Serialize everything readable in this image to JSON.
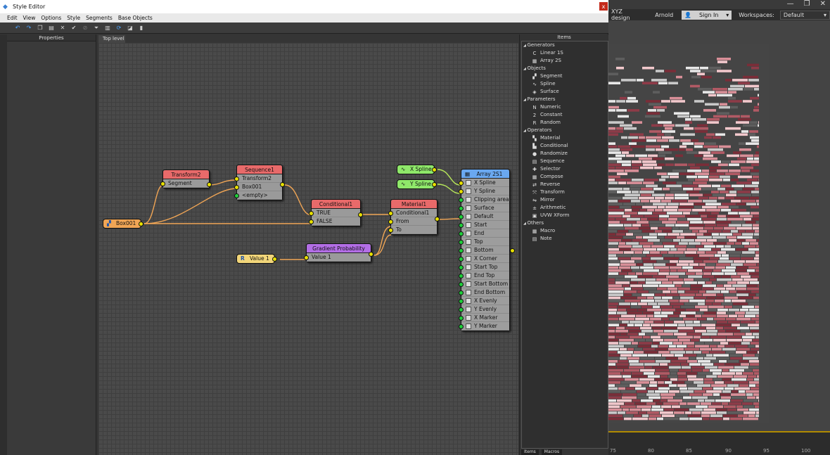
{
  "host": {
    "workspace_name": "XYZ design",
    "renderer": "Arnold",
    "sign_in": "Sign In",
    "workspaces_label": "Workspaces:",
    "workspace_value": "Default",
    "ruler_ticks": [
      "75",
      "80",
      "85",
      "90",
      "95",
      "100"
    ]
  },
  "window": {
    "title": "Style Editor",
    "close": "x"
  },
  "menu": [
    "Edit",
    "View",
    "Options",
    "Style",
    "Segments",
    "Base Objects"
  ],
  "panels": {
    "properties": "Properties",
    "canvas_tab": "Top level",
    "items": "Items",
    "items_tabs": [
      "Items",
      "Macros"
    ]
  },
  "tree": [
    {
      "category": "Generators",
      "items": [
        {
          "label": "Linear 1S",
          "icon": "C"
        },
        {
          "label": "Array 2S",
          "icon": "▦"
        }
      ]
    },
    {
      "category": "Objects",
      "items": [
        {
          "label": "Segment",
          "icon": "▞"
        },
        {
          "label": "Spline",
          "icon": "∿"
        },
        {
          "label": "Surface",
          "icon": "◈"
        }
      ]
    },
    {
      "category": "Parameters",
      "items": [
        {
          "label": "Numeric",
          "icon": "N"
        },
        {
          "label": "Constant",
          "icon": "2"
        },
        {
          "label": "Random",
          "icon": "R"
        }
      ]
    },
    {
      "category": "Operators",
      "items": [
        {
          "label": "Material",
          "icon": "▚"
        },
        {
          "label": "Conditional",
          "icon": "▙"
        },
        {
          "label": "Randomize",
          "icon": "●"
        },
        {
          "label": "Sequence",
          "icon": "▤"
        },
        {
          "label": "Selector",
          "icon": "✚"
        },
        {
          "label": "Compose",
          "icon": "▦"
        },
        {
          "label": "Reverse",
          "icon": "⇄"
        },
        {
          "label": "Transform",
          "icon": "⤧"
        },
        {
          "label": "Mirror",
          "icon": "⇋"
        },
        {
          "label": "Arithmetic",
          "icon": "±"
        },
        {
          "label": "UVW XForm",
          "icon": "▣"
        }
      ]
    },
    {
      "category": "Others",
      "items": [
        {
          "label": "Macro",
          "icon": "▦"
        },
        {
          "label": "Note",
          "icon": "▤"
        }
      ]
    }
  ],
  "nodes": {
    "box": "Box001",
    "transform2": {
      "title": "Transform2",
      "ports": [
        "Segment"
      ]
    },
    "sequence1": {
      "title": "Sequence1",
      "ports": [
        "Transform2",
        "Box001",
        "<empty>"
      ]
    },
    "conditional1": {
      "title": "Conditional1",
      "ports": [
        "TRUE",
        "FALSE"
      ]
    },
    "material1": {
      "title": "Material1",
      "ports": [
        "Conditional1",
        "From",
        "To"
      ]
    },
    "gradient": {
      "title": "Gradient Probability",
      "ports": [
        "Value 1"
      ]
    },
    "value1": "Value 1",
    "xspline": "X Spline",
    "yspline": "Y Spline",
    "array": {
      "title": "Array 2S1",
      "ports": [
        "X Spline",
        "Y Spline",
        "Clipping area",
        "Surface",
        "Default",
        "Start",
        "End",
        "Top",
        "Bottom",
        "X Corner",
        "Start Top",
        "End Top",
        "Start Bottom",
        "End Bottom",
        "X Evenly",
        "Y Evenly",
        "X Marker",
        "Y Marker"
      ]
    }
  },
  "colors": {
    "transform": "#e86a6a",
    "sequence": "#e86a6a",
    "conditional": "#e86a6a",
    "material": "#e86a6a",
    "gradient": "#b36ee6",
    "box": "#f0a555",
    "value": "#f2d67a",
    "spline": "#8fe86a",
    "array": "#6aa8f0"
  }
}
